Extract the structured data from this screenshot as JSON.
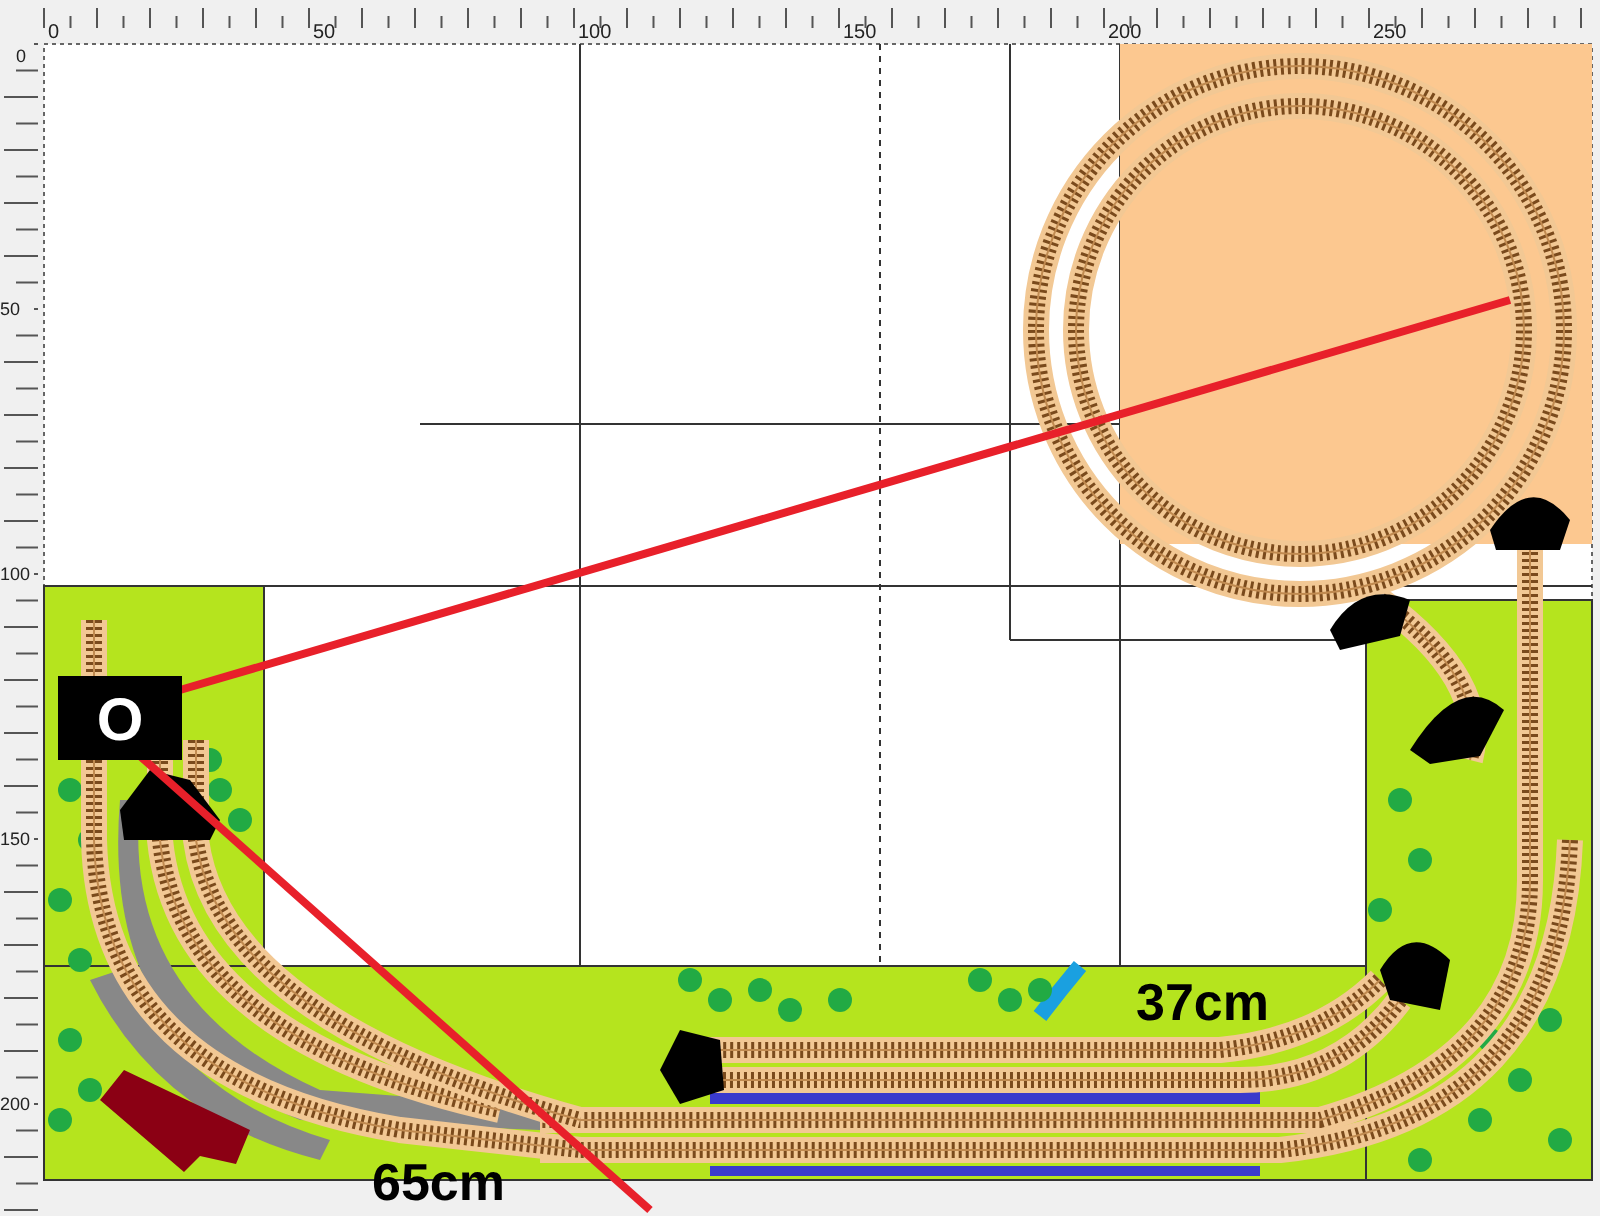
{
  "rulers": {
    "top": {
      "labels": [
        "0",
        "50",
        "100",
        "150",
        "200",
        "250"
      ]
    },
    "left": {
      "labels": [
        "0",
        "50",
        "100",
        "150",
        "200"
      ]
    }
  },
  "plan": {
    "signal_marker": "O",
    "dimension_labels": [
      {
        "text": "37cm",
        "kind": "upper"
      },
      {
        "text": "65cm",
        "kind": "lower"
      }
    ]
  }
}
